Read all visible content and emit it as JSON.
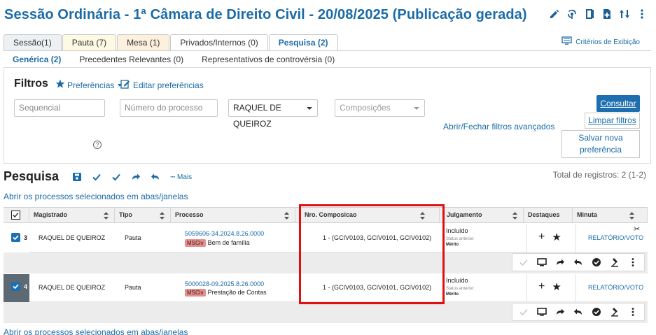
{
  "header": {
    "title": "Sessão Ordinária - 1ª Câmara de Direito Civil - 20/08/2025 (Publicação gerada)",
    "icons": [
      "pencil-icon",
      "broadcast-icon",
      "book-icon",
      "document-add-icon",
      "sort-arrows-icon",
      "kebab-menu-icon"
    ]
  },
  "tabs": [
    {
      "label": "Sessão(1)"
    },
    {
      "label": "Pauta (7)"
    },
    {
      "label": "Mesa (1)"
    },
    {
      "label": "Privados/Internos (0)"
    },
    {
      "label": "Pesquisa (2)"
    }
  ],
  "criteria_label": "Critérios de Exibição",
  "subtabs": [
    {
      "label": "Genérica (2)"
    },
    {
      "label": "Precedentes Relevantes (0)"
    },
    {
      "label": "Representativos de controvérsia (0)"
    }
  ],
  "filters": {
    "title": "Filtros",
    "preferences_label": "Preferências",
    "edit_preferences_label": "Editar preferências",
    "sequencial_placeholder": "Sequencial",
    "processo_placeholder": "Número do processo",
    "magistrado_value": "RAQUEL DE QUEIROZ",
    "composicoes_placeholder": "Composições",
    "advanced_toggle": "Abrir/Fechar filtros avançados",
    "consultar": "Consultar",
    "limpar": "Limpar filtros",
    "salvar": "Salvar nova preferência",
    "help": "?"
  },
  "results": {
    "title": "Pesquisa",
    "more_label": "Mais",
    "total": "Total de registros: 2 (1-2)",
    "open_selected": "Abrir os processos selecionados em abas/janelas"
  },
  "table": {
    "columns": [
      "Magistrado",
      "Tipo",
      "Processo",
      "Nro. Composicao",
      "Julgamento",
      "Destaques",
      "Minuta"
    ],
    "rows": [
      {
        "num": "3",
        "magistrado": "RAQUEL DE QUEIROZ",
        "tipo": "Pauta",
        "processo": "5059606-34.2024.8.26.0000",
        "badge": "MSCiv",
        "assunto": "Bem de família",
        "composicao": "1 - (GCIV0103, GCIV0101, GCIV0102)",
        "julgamento": "Incluído",
        "status_label": "Status anterior:",
        "status_value": "Mérito",
        "minuta": "RELATÓRIO/VOTO"
      },
      {
        "num": "4",
        "magistrado": "RAQUEL DE QUEIROZ",
        "tipo": "Pauta",
        "processo": "5000028-09.2025.8.26.0000",
        "badge": "MSCiv",
        "assunto": "Prestação de Contas",
        "composicao": "1 - (GCIV0103, GCIV0101, GCIV0102)",
        "julgamento": "Incluído",
        "status_label": "Status anterior:",
        "status_value": "Mérito",
        "minuta": "RELATÓRIO/VOTO"
      }
    ]
  },
  "colors": {
    "primary": "#1a6ba8",
    "button": "#1d6fb0",
    "badge": "#e68f8c",
    "highlight_box": "#e01010"
  }
}
